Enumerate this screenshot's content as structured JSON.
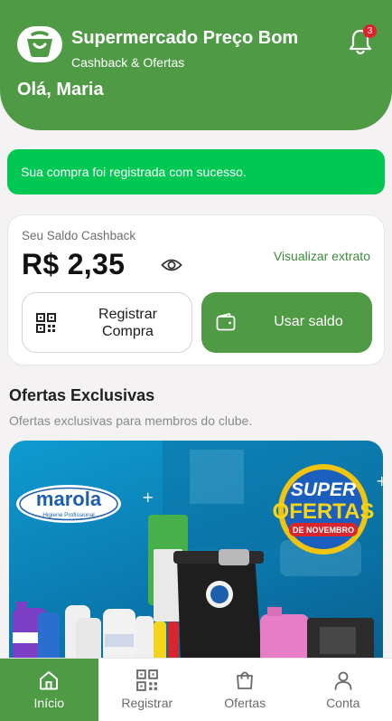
{
  "header": {
    "title": "Supermercado Preço Bom",
    "subtitle": "Cashback & Ofertas",
    "greeting": "Olá, Maria",
    "notification_count": "3"
  },
  "toast": {
    "message": "Sua compra foi registrada com sucesso."
  },
  "cashback": {
    "label": "Seu Saldo Cashback",
    "amount": "R$ 2,35",
    "statement_link": "Visualizar extrato",
    "register_button": "Registrar Compra",
    "use_balance_button": "Usar saldo"
  },
  "offers": {
    "title": "Ofertas Exclusivas",
    "subtitle": "Ofertas exclusivas para membros do clube.",
    "banner": {
      "brand": "marola",
      "brand_tagline": "Higiene Profissional",
      "promo_line1": "SUPER",
      "promo_line2": "OFERTAS",
      "promo_line3": "DE NOVEMBRO"
    }
  },
  "nav": {
    "items": [
      {
        "label": "Início",
        "icon": "home-icon",
        "active": true
      },
      {
        "label": "Registrar",
        "icon": "qr-code-icon",
        "active": false
      },
      {
        "label": "Ofertas",
        "icon": "shopping-bag-icon",
        "active": false
      },
      {
        "label": "Conta",
        "icon": "user-icon",
        "active": false
      }
    ]
  },
  "colors": {
    "primary": "#4f9a45",
    "success": "#00c853",
    "badge": "#e0202a",
    "background": "#f4f2f3"
  }
}
